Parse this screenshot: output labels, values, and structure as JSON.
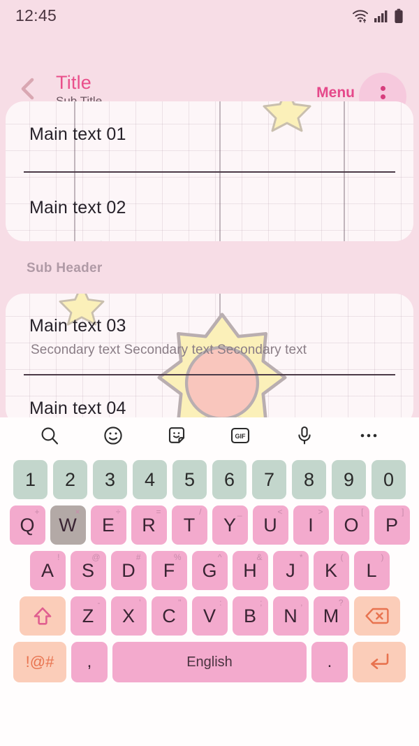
{
  "status_bar": {
    "time": "12:45",
    "icons": [
      "wifi-icon",
      "signal-icon",
      "battery-icon"
    ]
  },
  "app_bar": {
    "back_icon": "chevron-left-icon",
    "title": "Title",
    "subtitle": "Sub Title",
    "menu_label": "Menu",
    "overflow_icon": "more-vertical-icon",
    "accent_color": "#e94f8b"
  },
  "content": {
    "card1": {
      "rows": [
        {
          "main": "Main text 01"
        },
        {
          "main": "Main text 02"
        }
      ]
    },
    "sub_header": "Sub Header",
    "card2": {
      "rows": [
        {
          "main": "Main text 03",
          "secondary": "Secondary text Secondary text Secondary text"
        },
        {
          "main": "Main text 04"
        }
      ]
    }
  },
  "keyboard": {
    "toolbar": [
      {
        "name": "search-icon",
        "label": "Search"
      },
      {
        "name": "emoji-icon",
        "label": "Emoji"
      },
      {
        "name": "sticker-icon",
        "label": "Sticker"
      },
      {
        "name": "gif-icon",
        "label": "GIF"
      },
      {
        "name": "microphone-icon",
        "label": "Voice input"
      },
      {
        "name": "more-horizontal-icon",
        "label": "More"
      }
    ],
    "gif_label": "GIF",
    "number_row": [
      "1",
      "2",
      "3",
      "4",
      "5",
      "6",
      "7",
      "8",
      "9",
      "0"
    ],
    "row_q": [
      {
        "key": "Q",
        "sup": "+"
      },
      {
        "key": "W",
        "sup": "×",
        "pressed": true
      },
      {
        "key": "E",
        "sup": "÷"
      },
      {
        "key": "R",
        "sup": "="
      },
      {
        "key": "T",
        "sup": "/"
      },
      {
        "key": "Y",
        "sup": "_"
      },
      {
        "key": "U",
        "sup": "<"
      },
      {
        "key": "I",
        "sup": ">"
      },
      {
        "key": "O",
        "sup": "["
      },
      {
        "key": "P",
        "sup": "]"
      }
    ],
    "row_a": [
      {
        "key": "A",
        "sup": "!"
      },
      {
        "key": "S",
        "sup": "@"
      },
      {
        "key": "D",
        "sup": "#"
      },
      {
        "key": "F",
        "sup": "%"
      },
      {
        "key": "G",
        "sup": "^"
      },
      {
        "key": "H",
        "sup": "&"
      },
      {
        "key": "J",
        "sup": "*"
      },
      {
        "key": "K",
        "sup": "("
      },
      {
        "key": "L",
        "sup": ")"
      }
    ],
    "row_z": [
      {
        "key": "Z",
        "sup": "-"
      },
      {
        "key": "X",
        "sup": "'"
      },
      {
        "key": "C",
        "sup": "\""
      },
      {
        "key": "V",
        "sup": ":"
      },
      {
        "key": "B",
        "sup": ";"
      },
      {
        "key": "N",
        "sup": ","
      },
      {
        "key": "M",
        "sup": "?"
      }
    ],
    "shift_icon": "shift-arrow-up-icon",
    "backspace_icon": "backspace-icon",
    "symbols_key": "!@#",
    "comma_key": ",",
    "space_label": "English",
    "period_key": ".",
    "enter_icon": "enter-return-icon",
    "colors": {
      "number_key": "#c3d6cc",
      "letter_key": "#f3aacd",
      "pressed_key": "#b3a9a6",
      "function_key": "#fbcdb9"
    }
  }
}
